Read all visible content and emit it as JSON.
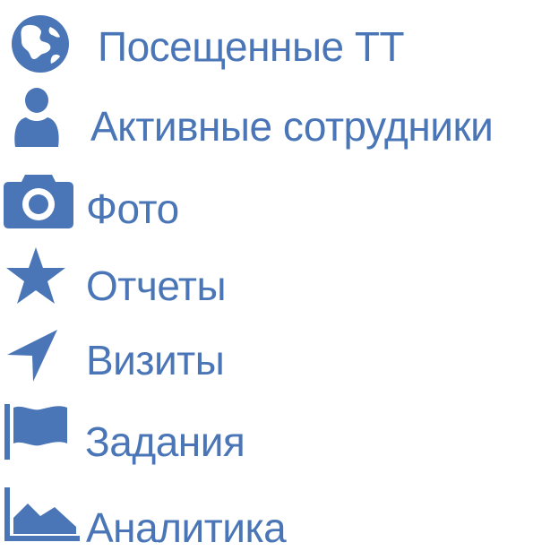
{
  "colors": {
    "accent": "#4a76b7"
  },
  "menu": {
    "items": [
      {
        "label": "Посещенные ТТ",
        "icon": "globe-icon"
      },
      {
        "label": "Активные сотрудники",
        "icon": "user-icon"
      },
      {
        "label": "Фото",
        "icon": "camera-icon"
      },
      {
        "label": "Отчеты",
        "icon": "star-icon"
      },
      {
        "label": "Визиты",
        "icon": "location-arrow-icon"
      },
      {
        "label": "Задания",
        "icon": "flag-icon"
      },
      {
        "label": "Аналитика",
        "icon": "area-chart-icon"
      }
    ]
  }
}
